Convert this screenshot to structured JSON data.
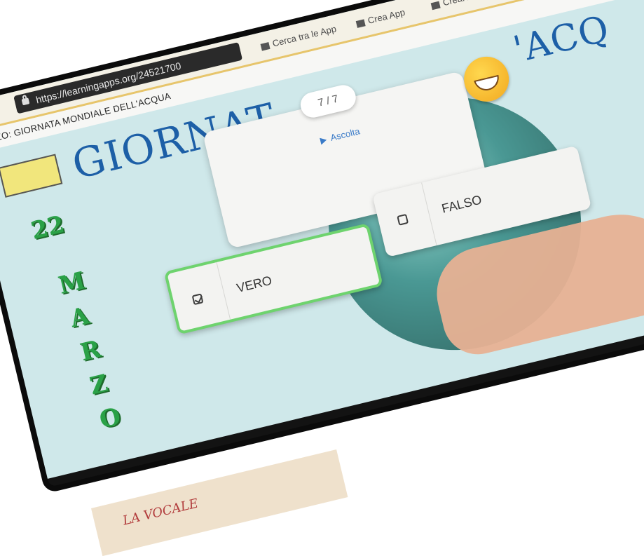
{
  "browser": {
    "url": "https://learningapps.org/24521700",
    "tab_partial": "acqua"
  },
  "toolbar": {
    "links": [
      {
        "label": "Cerca tra le App",
        "icon": "grid-icon"
      },
      {
        "label": "Crea App",
        "icon": "pencil-icon"
      },
      {
        "label": "Creare una collezione",
        "icon": "collection-icon"
      }
    ]
  },
  "app": {
    "title": "MARZO: GIORNATA MONDIALE DELL'ACQUA"
  },
  "background": {
    "title_left": "GIORNAT",
    "title_right": "'ACQ",
    "date_day": "22",
    "month_letters": [
      "M",
      "A",
      "R",
      "Z",
      "O"
    ]
  },
  "quiz": {
    "counter": "7 / 7",
    "listen_label": "Ascolta",
    "answers": [
      {
        "label": "VERO",
        "selected": true
      },
      {
        "label": "FALSO",
        "selected": false
      }
    ]
  },
  "desk": {
    "doodle_text": "LA VOCALE"
  },
  "colors": {
    "toolbar_accent": "#e7c56b",
    "title_blue": "#1d5fa7",
    "date_green": "#2aa147",
    "selected_border": "#6ed36e",
    "listen_blue": "#3a7bc8"
  }
}
